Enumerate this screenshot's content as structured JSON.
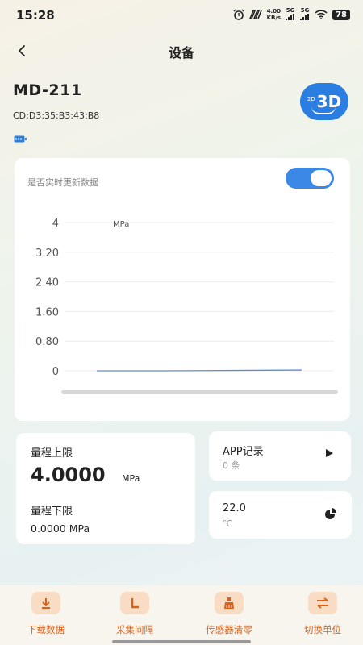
{
  "status_bar": {
    "time": "15:28",
    "network_speed": "4.00",
    "network_unit": "KB/s",
    "signal1_label": "5G",
    "signal2_label": "5G",
    "battery": "78"
  },
  "header": {
    "title": "设备"
  },
  "device": {
    "name": "MD-211",
    "mac": "CD:D3:35:B3:43:B8",
    "view_toggle_small": "2D",
    "view_toggle_big": "3D"
  },
  "realtime": {
    "label": "是否实时更新数据",
    "enabled": true
  },
  "chart_data": {
    "type": "line",
    "unit_label": "MPa",
    "y_ticks": [
      "4",
      "3.20",
      "2.40",
      "1.60",
      "0.80",
      "0"
    ],
    "ylim": [
      0,
      4
    ],
    "grid": true,
    "series": [
      {
        "values": [
          0,
          0,
          0.01,
          0.02
        ]
      }
    ],
    "line_color": "#5b8fd6"
  },
  "range": {
    "upper_label": "量程上限",
    "upper_value": "4.0000",
    "upper_unit": "MPa",
    "lower_label": "量程下限",
    "lower_value": "0.0000 MPa"
  },
  "app_record": {
    "label": "APP记录",
    "count": "0 条"
  },
  "temperature": {
    "value": "22.0",
    "unit": "℃"
  },
  "nav": {
    "download": "下载数据",
    "interval": "采集间隔",
    "clear": "传感器清零",
    "unit": "切换单位"
  },
  "colors": {
    "accent": "#3c88e6",
    "nav_text": "#d7621e",
    "nav_icon_bg": "#f8dcc4"
  }
}
